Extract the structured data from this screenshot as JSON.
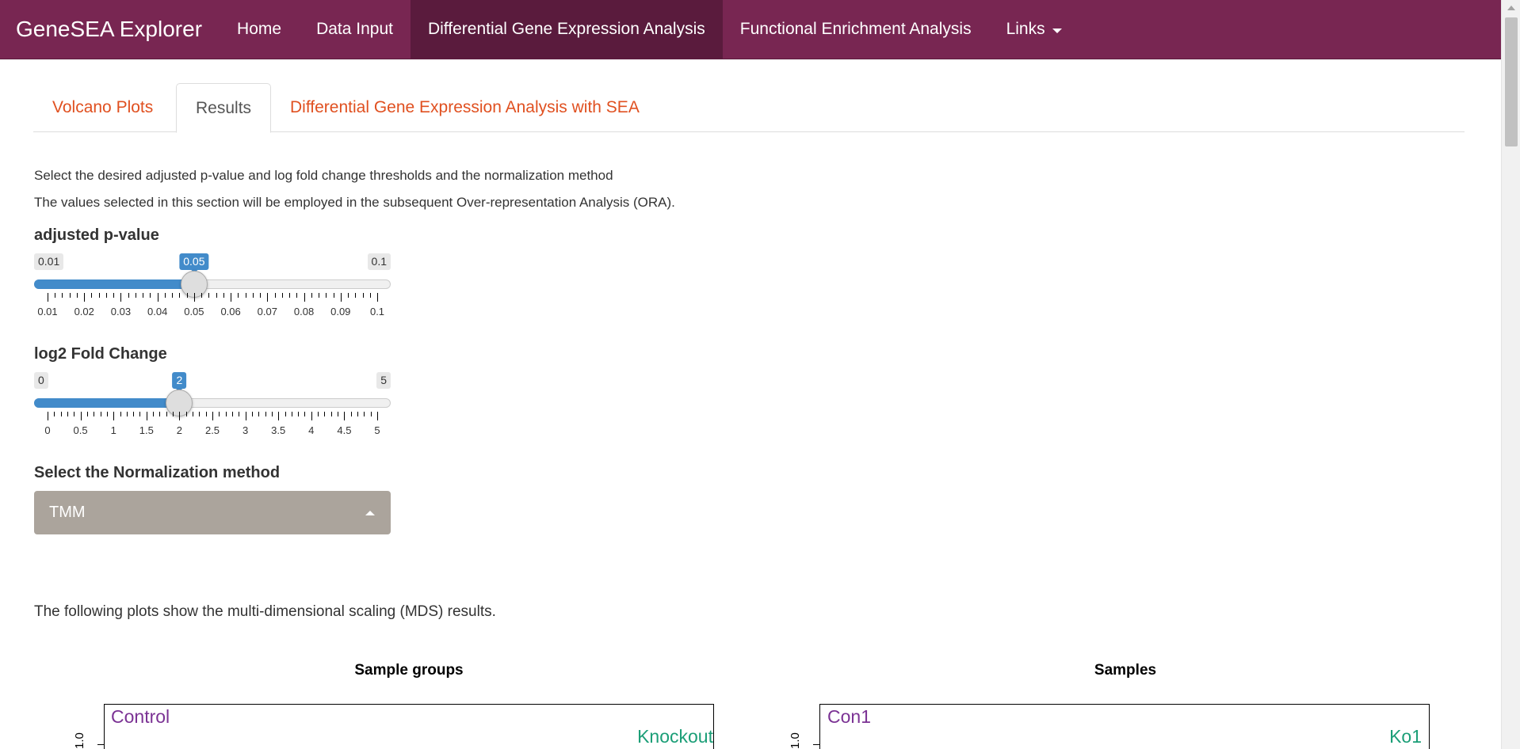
{
  "navbar": {
    "brand": "GeneSEA Explorer",
    "items": [
      "Home",
      "Data Input",
      "Differential Gene Expression Analysis",
      "Functional Enrichment Analysis",
      "Links"
    ],
    "active": "Differential Gene Expression Analysis",
    "bg_color": "#782652"
  },
  "tabs": {
    "items": [
      "Volcano Plots",
      "Results",
      "Differential Gene Expression Analysis with SEA"
    ],
    "active": "Results"
  },
  "intro": {
    "line1": "Select the desired adjusted p-value and log fold change thresholds and the normalization method",
    "line2": "The values selected in this section will be employed in the subsequent Over-representation Analysis (ORA)."
  },
  "pvalue_slider": {
    "label": "adjusted p-value",
    "min_label": "0.01",
    "max_label": "0.1",
    "value_label": "0.05",
    "min": 0.01,
    "max": 0.1,
    "value": 0.05,
    "tick_labels": [
      "0.01",
      "0.02",
      "0.03",
      "0.04",
      "0.05",
      "0.06",
      "0.07",
      "0.08",
      "0.09",
      "0.1"
    ]
  },
  "logfc_slider": {
    "label": "log2 Fold Change",
    "min_label": "0",
    "max_label": "5",
    "value_label": "2",
    "min": 0,
    "max": 5,
    "value": 2,
    "tick_labels": [
      "0",
      "0.5",
      "1",
      "1.5",
      "2",
      "2.5",
      "3",
      "3.5",
      "4",
      "4.5",
      "5"
    ]
  },
  "normalization": {
    "label": "Select the Normalization method",
    "selected": "TMM"
  },
  "mds_text": "The following plots show the multi-dimensional scaling (MDS) results.",
  "plots": {
    "left": {
      "title": "Sample groups",
      "label_a": "Control",
      "label_b": "Knockout",
      "ytick": "1.0"
    },
    "right": {
      "title": "Samples",
      "label_a": "Con1",
      "label_b": "Ko1",
      "ytick": "1.0"
    }
  },
  "colors": {
    "accent": "#428bca",
    "tab_link": "#e05020",
    "purple": "#7b3294",
    "green": "#1b9e77"
  }
}
